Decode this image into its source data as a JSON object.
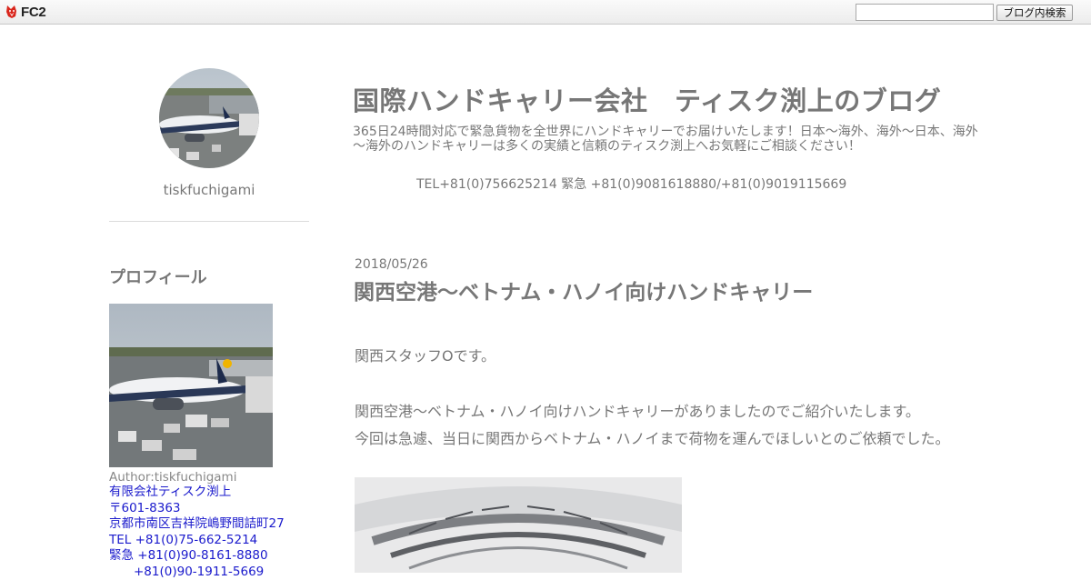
{
  "fc2_bar": {
    "logo_text": "FC2",
    "logo_icon": "fc2-fox-icon",
    "search_placeholder": "",
    "search_button": "ブログ内検索"
  },
  "sidebar": {
    "author_name": "tiskfuchigami",
    "profile_heading": "プロフィール",
    "author_line": "Author:tiskfuchigami",
    "info_lines": [
      "有限会社ティスク渕上",
      "〒601-8363",
      "京都市南区吉祥院嶋野間詰町27",
      "TEL +81(0)75-662-5214",
      "緊急 +81(0)90-8161-8880",
      "　　+81(0)90-1911-5669"
    ]
  },
  "header": {
    "title": "国際ハンドキャリー会社　ティスク渕上のブログ",
    "description": "365日24時間対応で緊急貨物を全世界にハンドキャリーでお届けいたします！日本～海外、海外～日本、海外～海外のハンドキャリーは多くの実績と信頼のティスク渕上へお気軽にご相談ください！",
    "tel": "TEL+81(0)756625214 緊急 +81(0)9081618880/+81(0)9019115669"
  },
  "post": {
    "date": "2018/05/26",
    "title": "関西空港～ベトナム・ハノイ向けハンドキャリー",
    "paragraphs": [
      "関西スタッフOです。",
      "関西空港～ベトナム・ハノイ向けハンドキャリーがありましたのでご紹介いたします。",
      "今回は急遽、当日に関西からベトナム・ハノイまで荷物を運んでほしいとのご依頼でした。"
    ]
  },
  "colors": {
    "text": "#777777",
    "link": "#1a1acc",
    "divider": "#dcdcdc",
    "bar_bg": "#ececec"
  }
}
